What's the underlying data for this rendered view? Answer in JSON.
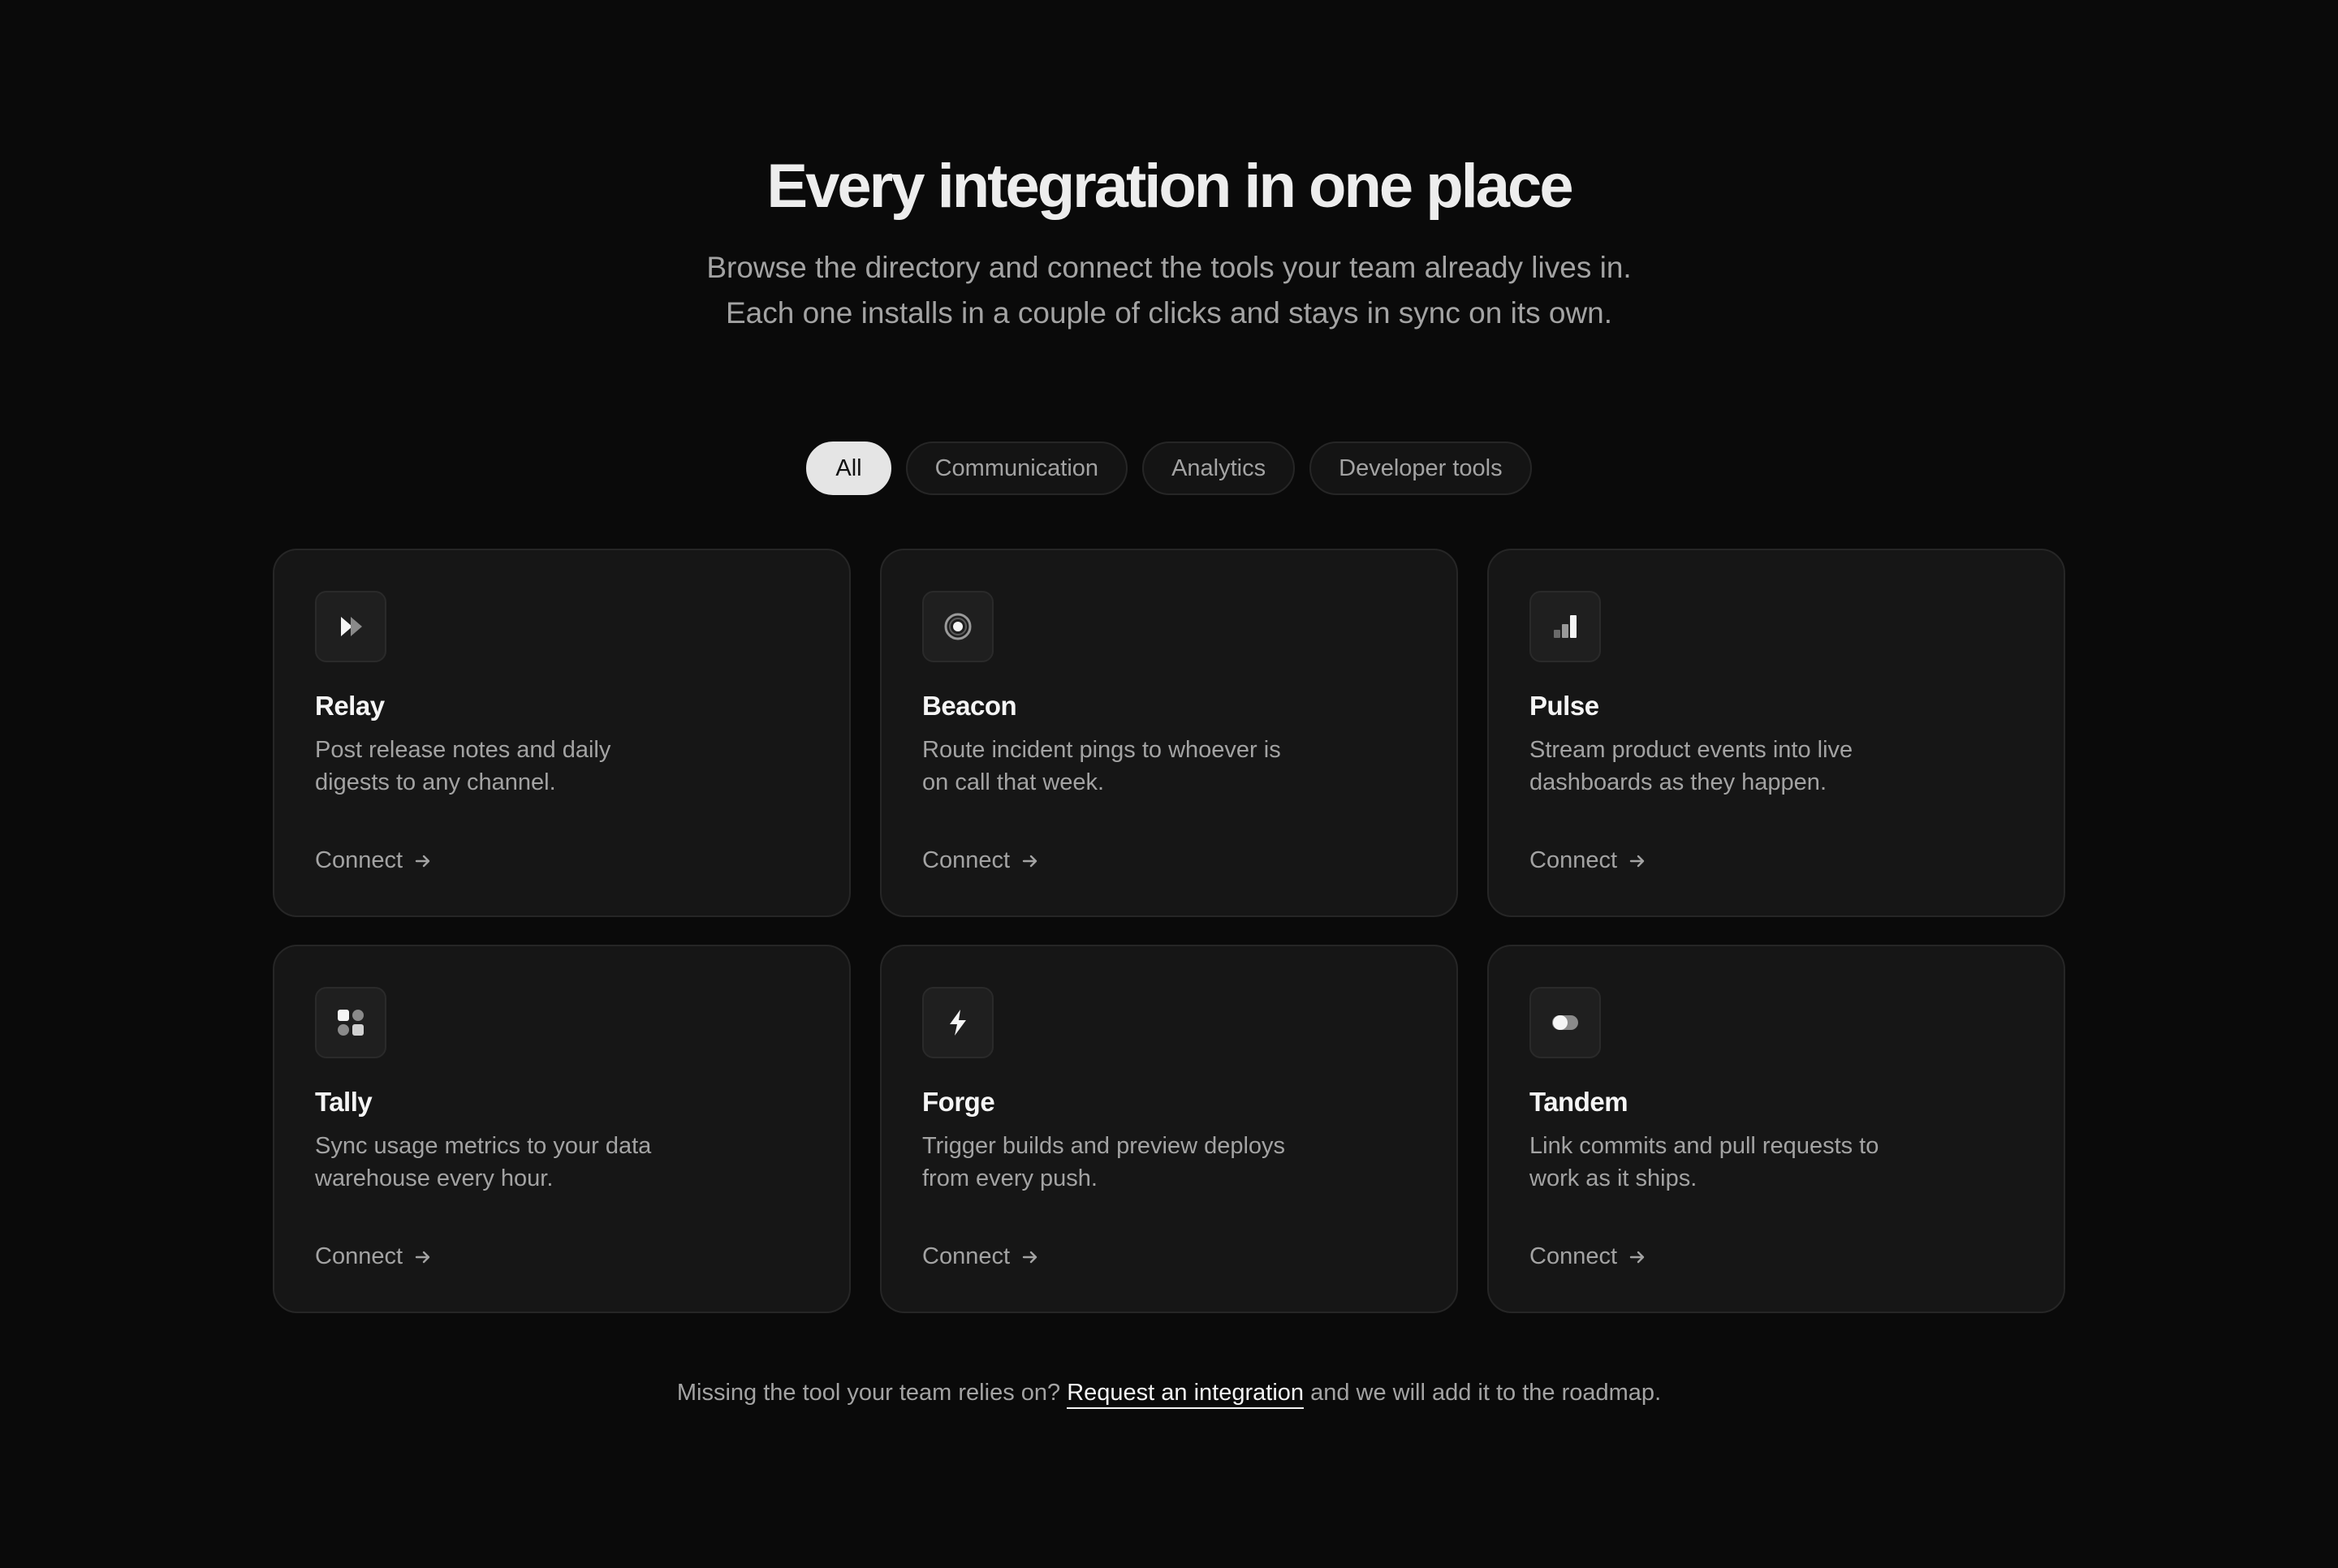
{
  "hero": {
    "title": "Every integration in one place",
    "subtitle": "Browse the directory and connect the tools your team already lives in. Each one installs in a couple of clicks and stays in sync on its own."
  },
  "filters": [
    {
      "label": "All",
      "active": true
    },
    {
      "label": "Communication",
      "active": false
    },
    {
      "label": "Analytics",
      "active": false
    },
    {
      "label": "Developer tools",
      "active": false
    }
  ],
  "cards": [
    {
      "name": "Relay",
      "description": "Post release notes and daily digests to any channel.",
      "cta": "Connect",
      "icon": "relay-icon"
    },
    {
      "name": "Beacon",
      "description": "Route incident pings to whoever is on call that week.",
      "cta": "Connect",
      "icon": "beacon-icon"
    },
    {
      "name": "Pulse",
      "description": "Stream product events into live dashboards as they happen.",
      "cta": "Connect",
      "icon": "bar-chart-icon"
    },
    {
      "name": "Tally",
      "description": "Sync usage metrics to your data warehouse every hour.",
      "cta": "Connect",
      "icon": "grid-icon"
    },
    {
      "name": "Forge",
      "description": "Trigger builds and preview deploys from every push.",
      "cta": "Connect",
      "icon": "bolt-icon"
    },
    {
      "name": "Tandem",
      "description": "Link commits and pull requests to work as it ships.",
      "cta": "Connect",
      "icon": "toggle-icon"
    }
  ],
  "footer": {
    "prefix": "Missing the tool your team relies on?",
    "link": "Request an integration",
    "suffix": "and we will add it to the roadmap."
  },
  "colors": {
    "background": "#0a0a0a",
    "card": "#161616",
    "border": "#262626",
    "text": "#ededed",
    "muted": "#a3a3a3",
    "chip_active": "#e5e5e5"
  }
}
